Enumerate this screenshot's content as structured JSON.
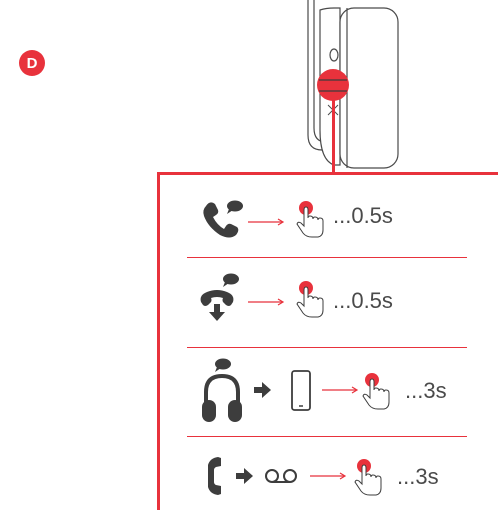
{
  "badge": {
    "label": "D",
    "color": "#e8323c"
  },
  "accent_color": "#e8323c",
  "icon_color": "#3d3d3d",
  "rows": [
    {
      "action_icon": "incoming-call-icon",
      "trigger_icon": "finger-press-icon",
      "duration": "...0.5s"
    },
    {
      "action_icon": "end-call-icon",
      "trigger_icon": "finger-press-icon",
      "duration": "...0.5s"
    },
    {
      "action_icon": "voice-assistant-headset-icon",
      "device_icon": "smartphone-icon",
      "trigger_icon": "finger-press-icon",
      "duration": "...3s"
    },
    {
      "action_icon": "call-icon",
      "device_icon": "voicemail-icon",
      "trigger_icon": "finger-press-icon",
      "duration": "...3s"
    }
  ]
}
